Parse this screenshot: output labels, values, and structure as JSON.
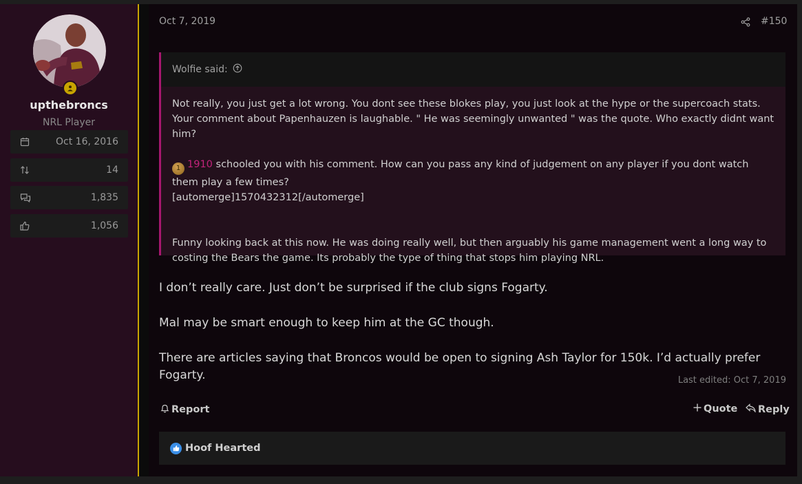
{
  "user": {
    "username": "upthebroncs",
    "title": "NRL Player",
    "stats": [
      {
        "icon": "calendar-icon",
        "value": "Oct 16, 2016"
      },
      {
        "icon": "trophy-points-icon",
        "value": "14"
      },
      {
        "icon": "messages-icon",
        "value": "1,835"
      },
      {
        "icon": "thumbs-up-icon",
        "value": "1,056"
      }
    ]
  },
  "post": {
    "date": "Oct 7, 2019",
    "number": "#150",
    "quote": {
      "author": "Wolfie said:",
      "paragraph1": "Not really, you just get a lot wrong. You dont see these blokes play, you just look at the hype or the supercoach stats. Your comment about Papenhauzen is laughable. \" He was seemingly unwanted \" was the quote. Who exactly didnt want him?",
      "mention_icon_text": "1",
      "mention": "1910",
      "paragraph2_rest": " schooled you with his comment. How can you pass any kind of judgement on any player if you dont watch them play a few times?",
      "automerge": "[automerge]1570432312[/automerge]",
      "paragraph3": "Funny looking back at this now. He was doing really well, but then arguably his game management went a long way to costing the Bears the game. Its probably the type of thing that stops him playing NRL."
    },
    "body": [
      "I don’t really care. Just don’t be surprised if the club signs Fogarty.",
      "Mal may be smart enough to keep him at the GC though.",
      "There are articles saying that Broncos would be open to signing Ash Taylor for 150k. I’d actually prefer Fogarty."
    ],
    "last_edited": "Last edited: Oct 7, 2019",
    "actions": {
      "report": "Report",
      "quote": "Quote",
      "reply": "Reply"
    },
    "reactions": {
      "users": "Hoof Hearted"
    }
  },
  "colors": {
    "accent": "#c8a400",
    "quote_border": "#a6176f",
    "mention": "#c2237b",
    "user_bg": "#260d1e",
    "content_bg": "#0e060c"
  }
}
